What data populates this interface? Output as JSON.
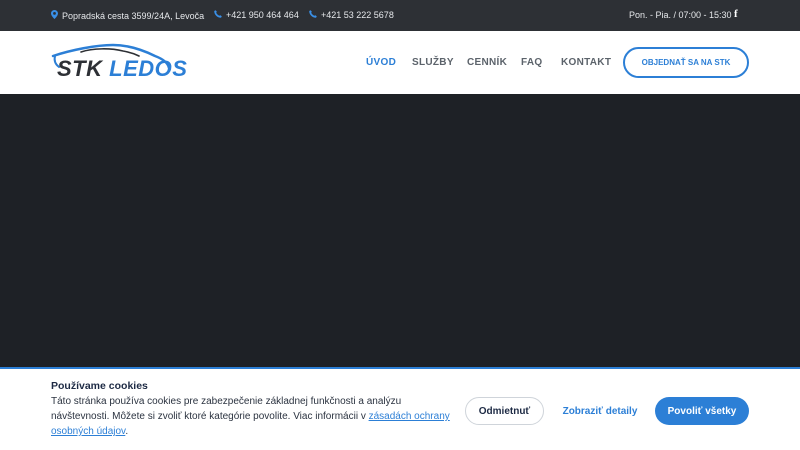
{
  "topbar": {
    "address": "Popradská cesta 3599/24A, Levoča",
    "phone1": "+421 950 464 464",
    "phone2": "+421 53 222 5678",
    "hours": "Pon. - Pia. / 07:00 - 15:30",
    "social": "f"
  },
  "header": {
    "logo": {
      "part1": "STK",
      "part2": "LEDOS"
    },
    "nav": [
      {
        "label": "ÚVOD",
        "active": true
      },
      {
        "label": "SLUŽBY"
      },
      {
        "label": "CENNÍK"
      },
      {
        "label": "FAQ"
      },
      {
        "label": "KONTAKT"
      }
    ],
    "cta": "OBJEDNAŤ SA NA STK"
  },
  "cookie": {
    "title": "Používame cookies",
    "text": "Táto stránka používa cookies pre zabezpečenie základnej funkčnosti a analýzu návštevnosti. Môžete si zvoliť ktoré kategórie povolite. Viac informácii v ",
    "link": "zásadách ochrany osobných údajov",
    "text_end": ".",
    "buttons": {
      "decline": "Odmietnuť",
      "details": "Zobraziť detaily",
      "accept": "Povoliť všetky"
    }
  },
  "colors": {
    "accent": "#2c7fd6",
    "topbar": "#2d3035",
    "hero": "#1e2126"
  },
  "icons": {
    "address": "map-marker-icon",
    "phone": "phone-icon",
    "social": "facebook-icon"
  }
}
